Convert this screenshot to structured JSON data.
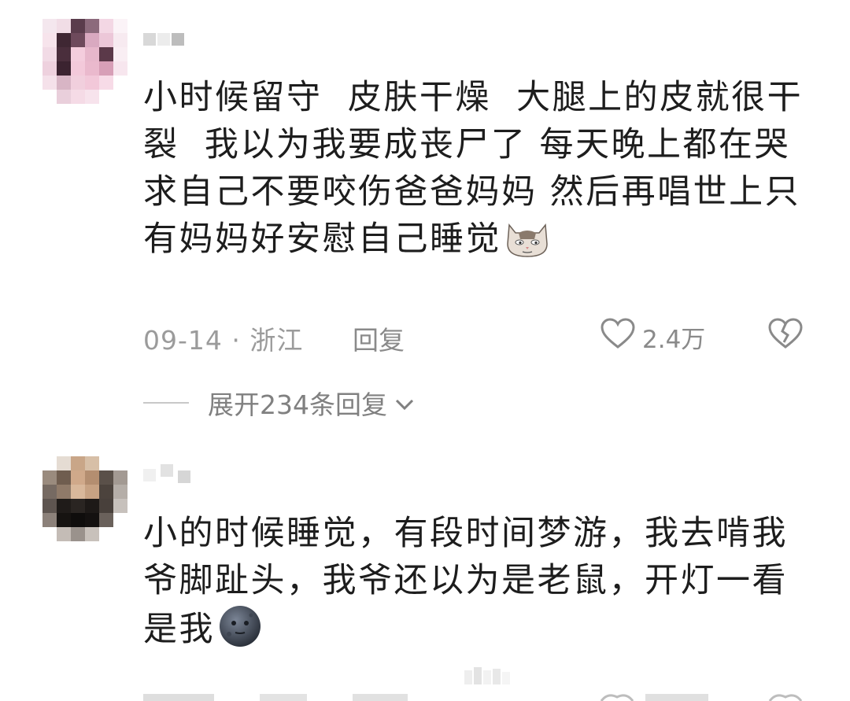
{
  "comments": [
    {
      "text": "小时候留守  皮肤干燥  大腿上的皮就很干裂  我以为我要成丧尸了 每天晚上都在哭求自己不要咬伤爸爸妈妈 然后再唱世上只有妈妈好安慰自己睡觉",
      "emoji": "cat-face-emoji",
      "date": "09-14",
      "location": "浙江",
      "reply_label": "回复",
      "likes": "2.4万",
      "expand_label": "展开234条回复"
    },
    {
      "text": "小的时候睡觉，有段时间梦游，我去啃我爷脚趾头，我爷还以为是老鼠，开灯一看是我",
      "emoji": "dark-moon-emoji"
    }
  ],
  "colors": {
    "text": "#1d1d1d",
    "meta": "#9b9b9b",
    "icon": "#8a8a8a"
  }
}
